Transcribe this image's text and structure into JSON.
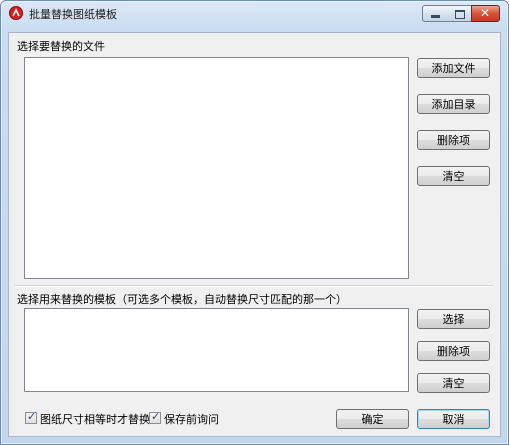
{
  "window": {
    "title": "批量替换图纸模板",
    "caption_buttons": {
      "minimize": "minimize",
      "maximize": "maximize",
      "close": "✕"
    }
  },
  "files_section": {
    "label": "选择要替换的文件",
    "buttons": {
      "add_file": "添加文件",
      "add_dir": "添加目录",
      "delete_item": "删除项",
      "clear": "清空"
    }
  },
  "template_section": {
    "label": "选择用来替换的模板（可选多个模板，自动替换尺寸匹配的那一个）",
    "buttons": {
      "select": "选择",
      "delete_item": "删除项",
      "clear": "清空"
    }
  },
  "options": {
    "same_size_only": {
      "label": "图纸尺寸相等时才替换",
      "checked": true
    },
    "ask_before_save": {
      "label": "保存前询问",
      "checked": true
    }
  },
  "footer": {
    "ok": "确定",
    "cancel": "取消"
  },
  "icons": {
    "app": "app-logo-icon",
    "check": "✓"
  }
}
